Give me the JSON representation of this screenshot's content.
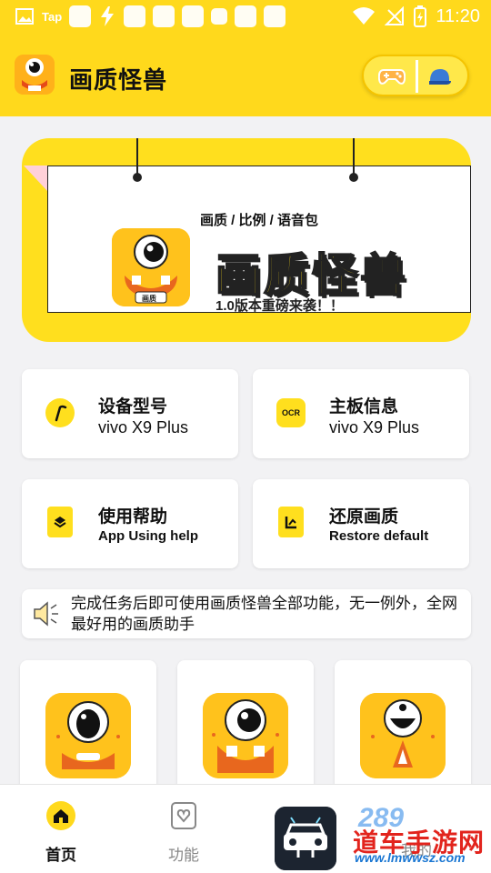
{
  "status_bar": {
    "app_label": "Tap",
    "time": "11:20"
  },
  "header": {
    "title": "画质怪兽",
    "pill_left_icon": "gamepad-icon",
    "pill_right_icon": "cap-icon"
  },
  "banner": {
    "subtitle": "画质 / 比例 / 语音包",
    "big_title": "画质怪兽",
    "slogan": "1.0版本重磅来袭！！",
    "icon_label": "画质"
  },
  "cards": [
    {
      "title": "设备型号",
      "value": "vivo X9 Plus",
      "icon": "speed-icon"
    },
    {
      "title": "主板信息",
      "value": "vivo X9 Plus",
      "icon": "ocr-icon",
      "icon_text": "OCR"
    },
    {
      "title": "使用帮助",
      "value": "App Using help",
      "icon": "layers-icon"
    },
    {
      "title": "还原画质",
      "value": "Restore default",
      "icon": "restore-icon"
    }
  ],
  "notice": {
    "text": "完成任务后即可使用画质怪兽全部功能，无一例外，全网最好用的画质助手"
  },
  "nav": {
    "items": [
      {
        "label": "首页",
        "icon": "home-icon",
        "active": true
      },
      {
        "label": "功能",
        "icon": "heart-icon",
        "active": false
      },
      {
        "label": "我的",
        "icon": "car-app-icon",
        "active": false
      }
    ]
  },
  "watermark": {
    "number": "289",
    "site_cn": "道车手游网",
    "url": "www.lmwwsz.com"
  },
  "colors": {
    "brand_yellow": "#ffd91c",
    "monster_orange": "#ffc21c",
    "background": "#f2f2f4"
  }
}
